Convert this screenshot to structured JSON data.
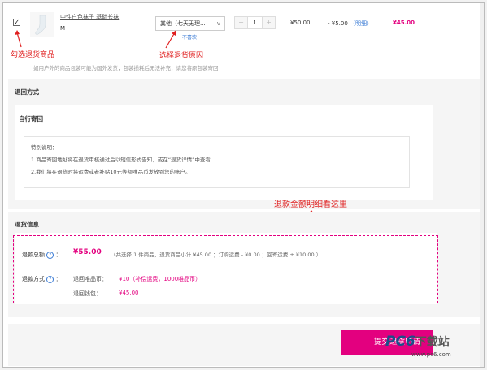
{
  "product": {
    "checked_mark": "✓",
    "name": "中性白色袜子 基础长袜",
    "size": "M",
    "reason_select": "其他（七天无理...",
    "reason_arrow": "v",
    "dislike_link": "不喜欢",
    "qty_minus": "−",
    "quantity": "1",
    "qty_plus": "+",
    "price": "¥50.00",
    "discount": "- ¥5.00",
    "discount_detail_link": "（明细）",
    "total": "¥45.00"
  },
  "annotations": {
    "select_goods": "勾选退货商品",
    "select_reason": "选择退货原因",
    "check_amount": "退款金额明细看这里"
  },
  "note": "如用户外的商品包装可能为国外发货，包装损耗后无法补充，请您将原包装寄回",
  "return_method": {
    "title": "退回方式",
    "option_title": "自行寄回",
    "info_title": "特别说明：",
    "info_line1": "1.商品寄回地址将在退货审核通过后以短信形式告知，或在“退货详情”中查看",
    "info_line2": "2.我们将在退货时将运费或者补贴10元等额唯品币发放到您的账户。"
  },
  "refund_info": {
    "title": "退货信息",
    "amount_label": "退款总额",
    "q_mark": "?",
    "colon": "：",
    "amount": "¥55.00",
    "summary": "（共选择 1 件商品，退货商品小计 ¥45.00 ；订购运费 - ¥0.00 ；回寄运费 + ¥10.00 ）",
    "method_label": "退款方式",
    "coin_label": "退回唯品币：",
    "coin_value": "¥10（补偿运费，1000唯品币）",
    "wallet_label": "退回钱包：",
    "wallet_value": "¥45.00"
  },
  "submit_label": "提交退货申请",
  "watermark": {
    "logo": "PC6",
    "cn": "下载站",
    "url": "www.pc6.com"
  },
  "colors": {
    "accent": "#e3007f",
    "annotation": "#e02020",
    "link": "#3a7bd5"
  }
}
